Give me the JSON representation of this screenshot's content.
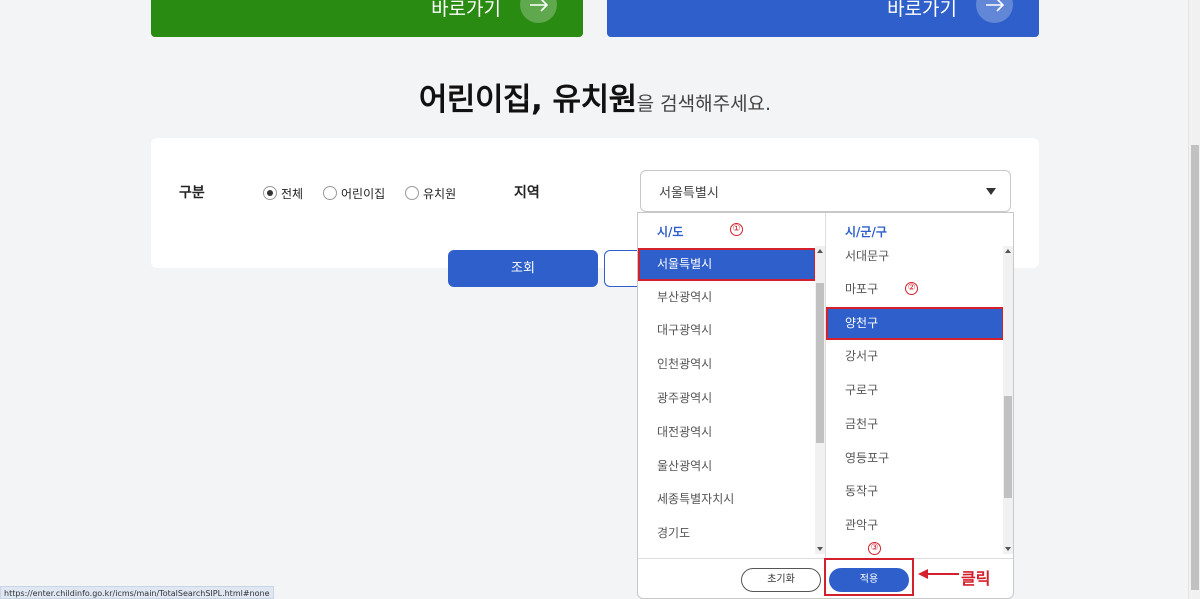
{
  "top_cards": {
    "left_label": "바로가기",
    "right_label": "바로가기",
    "colors": {
      "left": "#2a8b12",
      "right": "#2e5fca"
    },
    "icon": "arrow-right-icon"
  },
  "heading": {
    "strong": "어린이집, 유치원",
    "rest": "을 검색해주세요."
  },
  "search": {
    "type_label": "구분",
    "options": [
      "전체",
      "어린이집",
      "유치원"
    ],
    "selected_option": "전체",
    "region_label": "지역",
    "region_value": "서울특별시",
    "search_button": "조회"
  },
  "dropdown": {
    "left_header": "시/도",
    "left_items": [
      "서울특별시",
      "부산광역시",
      "대구광역시",
      "인천광역시",
      "광주광역시",
      "대전광역시",
      "울산광역시",
      "세종특별자치시",
      "경기도"
    ],
    "left_selected": "서울특별시",
    "right_header": "시/군/구",
    "right_items": [
      "서대문구",
      "마포구",
      "양천구",
      "강서구",
      "구로구",
      "금천구",
      "영등포구",
      "동작구",
      "관악구"
    ],
    "right_selected": "양천구",
    "reset_button": "초기화",
    "apply_button": "적용"
  },
  "annotations": {
    "markers": [
      "①",
      "②",
      "③"
    ],
    "click_text": "클릭",
    "color": "#d4202c"
  },
  "status_bar": "https://enter.childinfo.go.kr/icms/main/TotalSearchSIPL.html#none"
}
